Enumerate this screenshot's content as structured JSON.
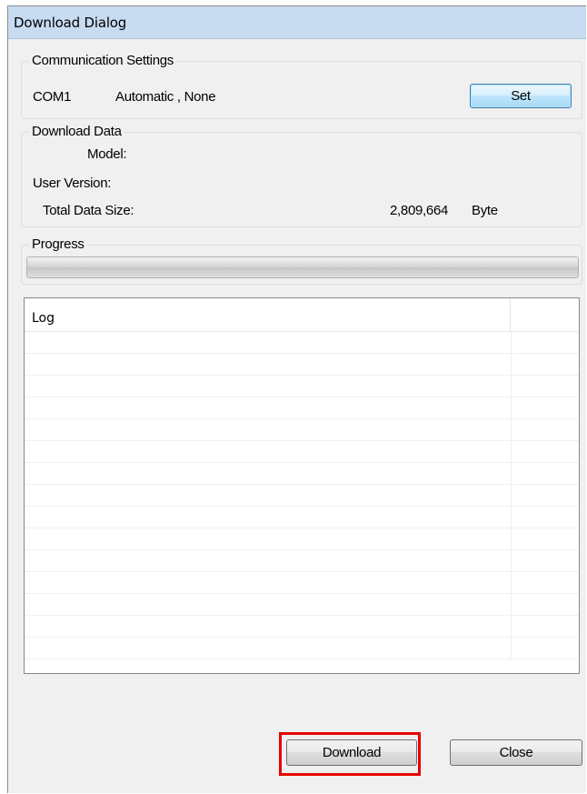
{
  "window": {
    "title": "Download Dialog"
  },
  "communication": {
    "legend": "Communication Settings",
    "port": "COM1",
    "mode": "Automatic , None",
    "set_label": "Set"
  },
  "download_data": {
    "legend": "Download Data",
    "model_label": "Model:",
    "user_version_label": "User Version:",
    "total_size_label": "Total Data Size:",
    "total_size_value": "2,809,664",
    "total_size_unit": "Byte"
  },
  "progress": {
    "legend": "Progress",
    "value": 0
  },
  "log": {
    "column_header": "Log",
    "rows": [
      "",
      "",
      "",
      "",
      "",
      "",
      "",
      "",
      "",
      "",
      "",
      "",
      "",
      "",
      ""
    ]
  },
  "buttons": {
    "download_label": "Download",
    "close_label": "Close"
  },
  "colors": {
    "highlight": "#e60000",
    "titlebar": "#c7dbf1",
    "dialog_bg": "#f0f0f0"
  }
}
